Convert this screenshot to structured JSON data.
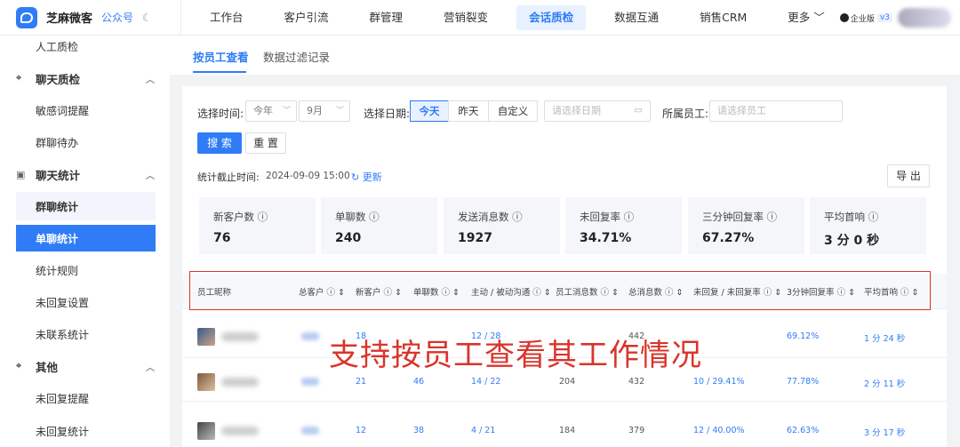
{
  "app": {
    "name": "芝麻微客",
    "sub": "公众号"
  },
  "nav": [
    "工作台",
    "客户引流",
    "群管理",
    "营销裂变",
    "会话质检",
    "数据互通",
    "销售CRM",
    "更多"
  ],
  "user": {
    "edition": "企业版",
    "version": "v3"
  },
  "sidebar": {
    "item_top": "人工质检",
    "group_chat_check": "聊天质检",
    "sensitive": "敏感词提醒",
    "group_todo": "群聊待办",
    "group_stats": "聊天统计",
    "group_chat_stat": "群聊统计",
    "single_stat": "单聊统计",
    "rules": "统计规则",
    "noreply_set": "未回复设置",
    "uncontacted": "未联系统计",
    "group_other": "其他",
    "noreply_remind": "未回复提醒",
    "noreply_stat": "未回复统计"
  },
  "tabs": {
    "by_employee": "按员工查看",
    "filter_log": "数据过滤记录"
  },
  "filters": {
    "time_label": "选择时间:",
    "year": "今年",
    "month": "9月",
    "date_label": "选择日期:",
    "today": "今天",
    "yesterday": "昨天",
    "custom": "自定义",
    "date_placeholder": "请选择日期",
    "staff_label": "所属员工:",
    "staff_placeholder": "请选择员工",
    "search": "搜 索",
    "reset": "重 置"
  },
  "stat_time": {
    "label": "统计截止时间:",
    "value": "2024-09-09 15:00",
    "refresh": "更新"
  },
  "export": "导 出",
  "stats": [
    {
      "label": "新客户数",
      "value": "76"
    },
    {
      "label": "单聊数",
      "value": "240"
    },
    {
      "label": "发送消息数",
      "value": "1927"
    },
    {
      "label": "未回复率",
      "value": "34.71%"
    },
    {
      "label": "三分钟回复率",
      "value": "67.27%"
    },
    {
      "label": "平均首响",
      "value": "3 分 0 秒"
    }
  ],
  "columns": [
    "员工昵称",
    "总客户",
    "新客户",
    "单聊数",
    "主动 / 被动沟通",
    "员工消息数",
    "总消息数",
    "未回复 / 未回复率",
    "3分钟回复率",
    "平均首响"
  ],
  "rows": [
    {
      "new": "18",
      "single": "",
      "comm": "12 / 28",
      "emp_msg": "",
      "total": "442",
      "noreply": "",
      "rate3": "69.12%",
      "avg": "1 分 24 秒"
    },
    {
      "new": "21",
      "single": "46",
      "comm": "14 / 22",
      "emp_msg": "204",
      "total": "432",
      "noreply": "10 / 29.41%",
      "rate3": "77.78%",
      "avg": "2 分 11 秒"
    },
    {
      "new": "12",
      "single": "38",
      "comm": "4 / 21",
      "emp_msg": "184",
      "total": "379",
      "noreply": "12 / 40.00%",
      "rate3": "62.63%",
      "avg": "3 分 17 秒"
    }
  ],
  "overlay_text": "支持按员工查看其工作情况"
}
